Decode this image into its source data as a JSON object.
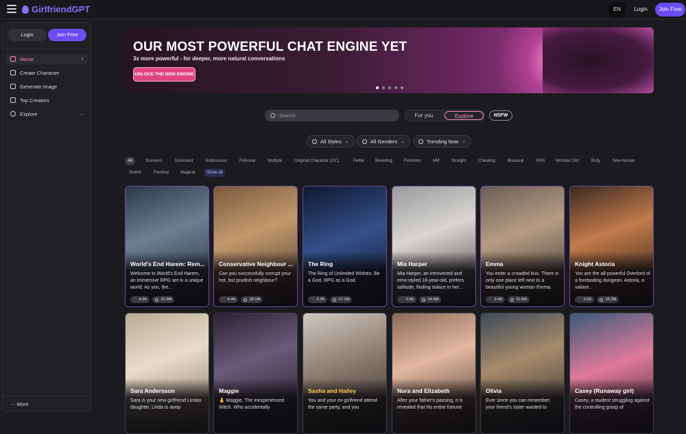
{
  "header": {
    "logo_text": "GirlfriendGPT",
    "lang_label": "EN",
    "login_label": "Login",
    "join_label": "Join Free"
  },
  "sidebar": {
    "login_label": "Login",
    "join_label": "Join Free",
    "items": [
      {
        "label": "Home",
        "icon": "home-icon",
        "trail": "+"
      },
      {
        "label": "Create Character",
        "icon": "edit-icon",
        "trail": ""
      },
      {
        "label": "Generate Image",
        "icon": "image-icon",
        "trail": ""
      },
      {
        "label": "Top Creators",
        "icon": "trophy-icon",
        "trail": ""
      },
      {
        "label": "Explore",
        "icon": "compass-icon",
        "trail": "⌄"
      }
    ],
    "more_label": "··· More"
  },
  "hero": {
    "title": "OUR MOST POWERFUL CHAT ENGINE YET",
    "subtitle": "3x more powerful - for deeper, more natural conversations",
    "cta": "UNLOCK THE NEW ENGINE",
    "slides": 5,
    "active_slide": 1
  },
  "search": {
    "placeholder": "Search"
  },
  "tabs": {
    "for_you": "For you",
    "explore": "Explore",
    "nsfw": "NSFW"
  },
  "filters": [
    {
      "label": "All Styles",
      "icon": "palette-icon"
    },
    {
      "label": "All Genders",
      "icon": "gender-icon"
    },
    {
      "label": "Trending Now",
      "icon": "trend-icon"
    }
  ],
  "tags_row1": [
    "All",
    "Scenario",
    "Dominant",
    "Submissive",
    "Fictional",
    "Multiple",
    "Original Character (OC)",
    "Petite",
    "Breeding",
    "Femdom",
    "Milf",
    "Straight",
    "Cheating",
    "Bisexual",
    "RPG",
    "Monster Girl",
    "Bully",
    "Non-human"
  ],
  "tags_row2": [
    "Switch",
    "Femboy",
    "Magical"
  ],
  "show_all": "Show all",
  "cards": [
    {
      "name": "World's End Harem: Rem...",
      "desc": "Welcome to World's End Harem, an immersive RPG set in a unique world. As you, the...",
      "likes": "4.6K",
      "chats": "22.9M",
      "gold": false
    },
    {
      "name": "Conservative Neighbour ...",
      "desc": "Can you successfully corrupt your hot, but prudish neighbour?",
      "likes": "4.4K",
      "chats": "18.1M",
      "gold": false
    },
    {
      "name": "The Ring",
      "desc": "The Ring of Unlimited Wishes. Be a God, RPG as a God.",
      "likes": "2.3K",
      "chats": "17.1M",
      "gold": false
    },
    {
      "name": "Mia Harper",
      "desc": "Mia Harper, an introverted and emo-styled 18-year-old, prefers solitude, finding solace in her...",
      "likes": "3.9K",
      "chats": "14.4M",
      "gold": false
    },
    {
      "name": "Emma",
      "desc": "You enter a crowded bus. There is only one place left next to a beautiful young woman Emma.",
      "likes": "3.4K",
      "chats": "11.6M",
      "gold": false
    },
    {
      "name": "Knight Astoria",
      "desc": "You are the all-powerful Overlord of a foreboding dungeon. Astoria, a valiant...",
      "likes": "2.5K",
      "chats": "10.2M",
      "gold": false
    },
    {
      "name": "Sara Andersson",
      "desc": "Sara is your new girlfriend Lindas daughter. Linda is away",
      "likes": "",
      "chats": "",
      "gold": false
    },
    {
      "name": "Maggie",
      "desc": "👃 Maggie, The inexperienced Witch. Who accidentally",
      "likes": "",
      "chats": "",
      "gold": false
    },
    {
      "name": "Sasha and Hailey",
      "desc": "You and your ex-girlfriend attend the same party, and you",
      "likes": "",
      "chats": "",
      "gold": true
    },
    {
      "name": "Nora and Elizabeth",
      "desc": "After your father's passing, it is revealed that his entire fortune",
      "likes": "",
      "chats": "",
      "gold": false
    },
    {
      "name": "Olivia",
      "desc": "Ever since you can remember, your friend's sister wanted to",
      "likes": "",
      "chats": "",
      "gold": false
    },
    {
      "name": "Casey (Runaway girl)",
      "desc": "Casey, a student struggling against the controlling grasp of",
      "likes": "",
      "chats": "",
      "gold": false
    }
  ],
  "colors": {
    "accent": "#6a4cf0",
    "pink": "#ff8fb8",
    "cta": "#e0457f",
    "gold": "#ffcf4d"
  }
}
